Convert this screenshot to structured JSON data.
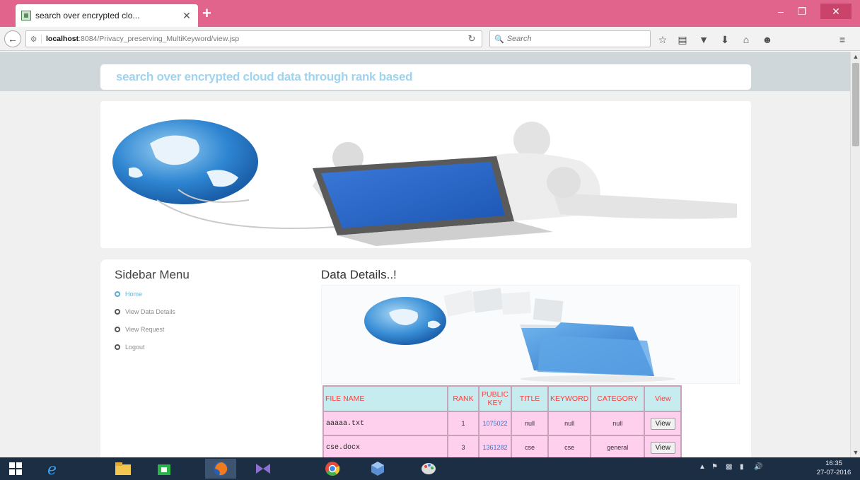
{
  "browser": {
    "tab_title": "search over encrypted clo...",
    "tab_close": "✕",
    "new_tab": "+",
    "url_host": "localhost",
    "url_rest": ":8084/Privacy_preserving_MultiKeyword/view.jsp",
    "search_placeholder": "Search"
  },
  "page": {
    "header_title": "search over encrypted cloud data through rank based",
    "sidebar_title": "Sidebar Menu",
    "sidebar_items": [
      {
        "label": "Home"
      },
      {
        "label": "View Data Details"
      },
      {
        "label": "View Request"
      },
      {
        "label": "Logout"
      }
    ],
    "main_title": "Data Details..!"
  },
  "table": {
    "headers": [
      "FILE NAME",
      "RANK",
      "PUBLIC KEY",
      "TITLE",
      "KEYWORD",
      "CATEGORY",
      "View"
    ],
    "rows": [
      {
        "file": "aaaaa.txt",
        "rank": "1",
        "key": "1075022",
        "title": "null",
        "keyword": "null",
        "category": "null",
        "action": "View"
      },
      {
        "file": "cse.docx",
        "rank": "3",
        "key": "1361282",
        "title": "cse",
        "keyword": "cse",
        "category": "general",
        "action": "View"
      }
    ]
  },
  "taskbar": {
    "time": "16:35",
    "date": "27-07-2016"
  },
  "colors": {
    "titlebar": "#e0648c",
    "header_title": "#9fd4f0",
    "table_header_bg": "#c6ecef",
    "table_header_text": "#ff3d3d",
    "table_cell_bg": "#ffd0ee",
    "taskbar": "#1c2e44"
  }
}
